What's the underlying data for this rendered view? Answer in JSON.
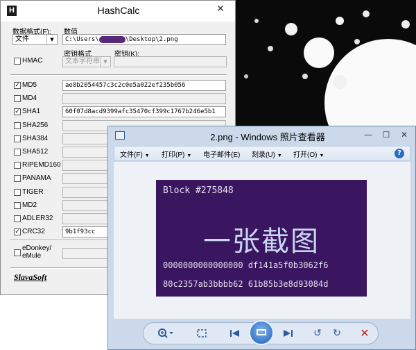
{
  "hashcalc": {
    "title": "HashCalc",
    "close": "✕",
    "data_format_label": "数据格式(F):",
    "data_format_value": "文件",
    "data_label": "数值",
    "data_path_prefix": "C:\\Users\\",
    "data_path_suffix": "\\Desktop\\2.png",
    "hmac_label": "HMAC",
    "key_format_label": "密钥格式",
    "key_format_value": "文本字符串",
    "key_label": "密钥(K):",
    "algorithms": [
      {
        "name": "MD5",
        "checked": true,
        "value": "ae8b2054457c3c2c0e5a022ef235b056"
      },
      {
        "name": "MD4",
        "checked": false,
        "value": ""
      },
      {
        "name": "SHA1",
        "checked": true,
        "value": "60f07d8acd9399afc35470cf399c1767b246e5b1"
      },
      {
        "name": "SHA256",
        "checked": false,
        "value": ""
      },
      {
        "name": "SHA384",
        "checked": false,
        "value": ""
      },
      {
        "name": "SHA512",
        "checked": false,
        "value": ""
      },
      {
        "name": "RIPEMD160",
        "checked": false,
        "value": ""
      },
      {
        "name": "PANAMA",
        "checked": false,
        "value": ""
      },
      {
        "name": "TIGER",
        "checked": false,
        "value": ""
      },
      {
        "name": "MD2",
        "checked": false,
        "value": ""
      },
      {
        "name": "ADLER32",
        "checked": false,
        "value": ""
      },
      {
        "name": "CRC32",
        "checked": true,
        "value": "9b1f93cc"
      }
    ],
    "edonkey_line1": "eDonkey/",
    "edonkey_line2": "eMule",
    "brand": "SlavaSoft"
  },
  "viewer": {
    "title": "2.png - Windows 照片查看器",
    "menu": [
      "文件(F)",
      "打印(P)",
      "电子邮件(E)",
      "刻录(U)",
      "打开(O)"
    ],
    "help": "?",
    "image": {
      "block_text": "Block #275848",
      "big_text": "一张截图",
      "hex_line1": "0000000000000000 df141a5f0b3062f6",
      "hex_line2": "80c2357ab3bbbb62 61b85b3e8d93084d"
    },
    "toolbar_icons": [
      "zoom-icon",
      "fit-window-icon",
      "previous-icon",
      "slideshow-icon",
      "next-icon",
      "rotate-ccw-icon",
      "rotate-cw-icon",
      "delete-icon"
    ]
  }
}
